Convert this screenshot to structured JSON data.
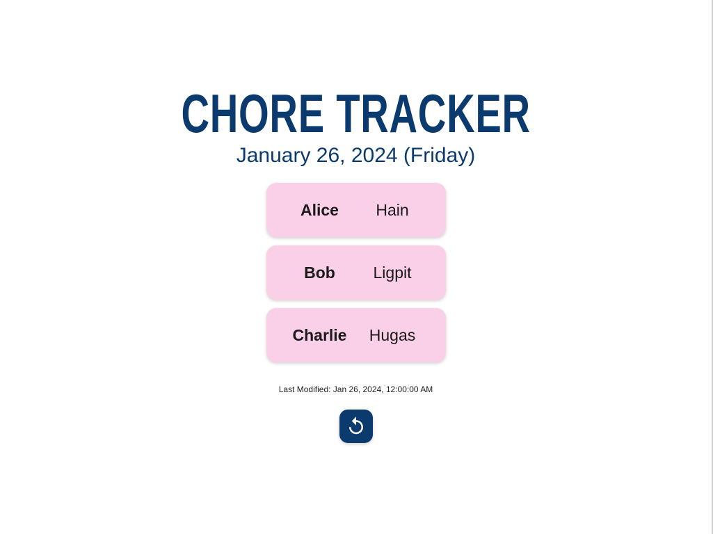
{
  "header": {
    "title": "CHORE TRACKER",
    "date": "January 26, 2024 (Friday)"
  },
  "assignments": [
    {
      "name": "Alice",
      "chore": "Hain"
    },
    {
      "name": "Bob",
      "chore": "Ligpit"
    },
    {
      "name": "Charlie",
      "chore": "Hugas"
    }
  ],
  "footer": {
    "last_modified": "Last Modified: Jan 26, 2024, 12:00:00 AM",
    "reset_icon": "reset-icon"
  },
  "colors": {
    "primary": "#0a3a6e",
    "card_background": "#f9d0e8",
    "text": "#1a1a1a"
  }
}
